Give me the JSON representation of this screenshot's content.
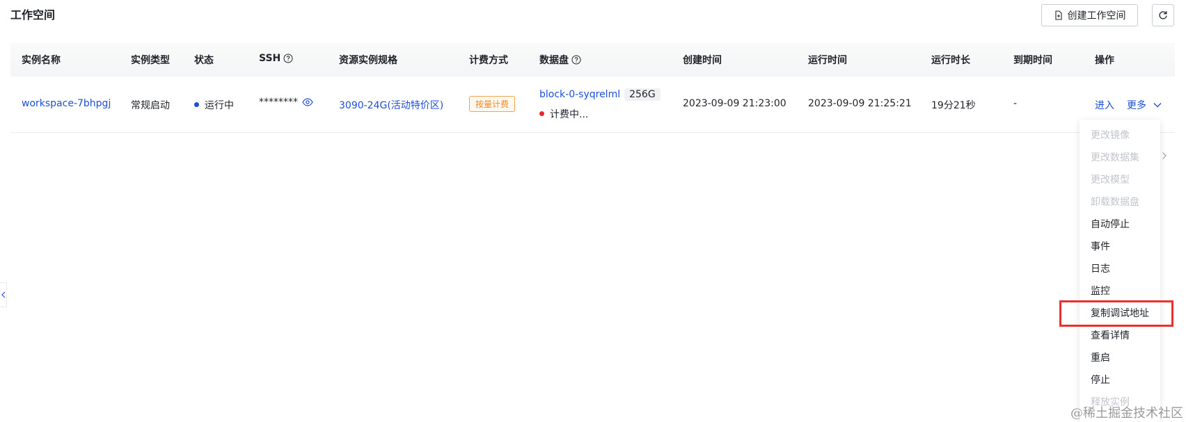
{
  "header": {
    "title": "工作空间",
    "create_label": "创建工作空间"
  },
  "columns": {
    "name": "实例名称",
    "type": "实例类型",
    "status": "状态",
    "ssh": "SSH",
    "spec": "资源实例规格",
    "billing": "计费方式",
    "disk": "数据盘",
    "created": "创建时间",
    "started": "运行时间",
    "duration": "运行时长",
    "expires": "到期时间",
    "actions": "操作"
  },
  "row": {
    "name": "workspace-7bhpgj",
    "type": "常规启动",
    "status": "运行中",
    "ssh_masked": "********",
    "spec": "3090-24G(活动特价区)",
    "billing": "按量计费",
    "disk_name": "block-0-syqrelml",
    "disk_size": "256G",
    "disk_billing": "计费中...",
    "created": "2023-09-09 21:23:00",
    "started": "2023-09-09 21:25:21",
    "duration": "19分21秒",
    "expires": "-",
    "enter_label": "进入",
    "more_label": "更多"
  },
  "menu": [
    {
      "label": "更改镜像",
      "disabled": true
    },
    {
      "label": "更改数据集",
      "disabled": true
    },
    {
      "label": "更改模型",
      "disabled": true
    },
    {
      "label": "卸载数据盘",
      "disabled": true
    },
    {
      "label": "自动停止",
      "disabled": false
    },
    {
      "label": "事件",
      "disabled": false
    },
    {
      "label": "日志",
      "disabled": false
    },
    {
      "label": "监控",
      "disabled": false
    },
    {
      "label": "复制调试地址",
      "disabled": false,
      "highlighted": true
    },
    {
      "label": "查看详情",
      "disabled": false
    },
    {
      "label": "重启",
      "disabled": false
    },
    {
      "label": "停止",
      "disabled": false
    },
    {
      "label": "释放实例",
      "disabled": true
    }
  ],
  "watermark": "@稀土掘金技术社区",
  "colors": {
    "link": "#1c4fd8",
    "highlight": "#ec2f2c",
    "billing_tag": "#f08a24",
    "running_dot": "#1c4fd8",
    "billing_dot": "#e0282e"
  }
}
